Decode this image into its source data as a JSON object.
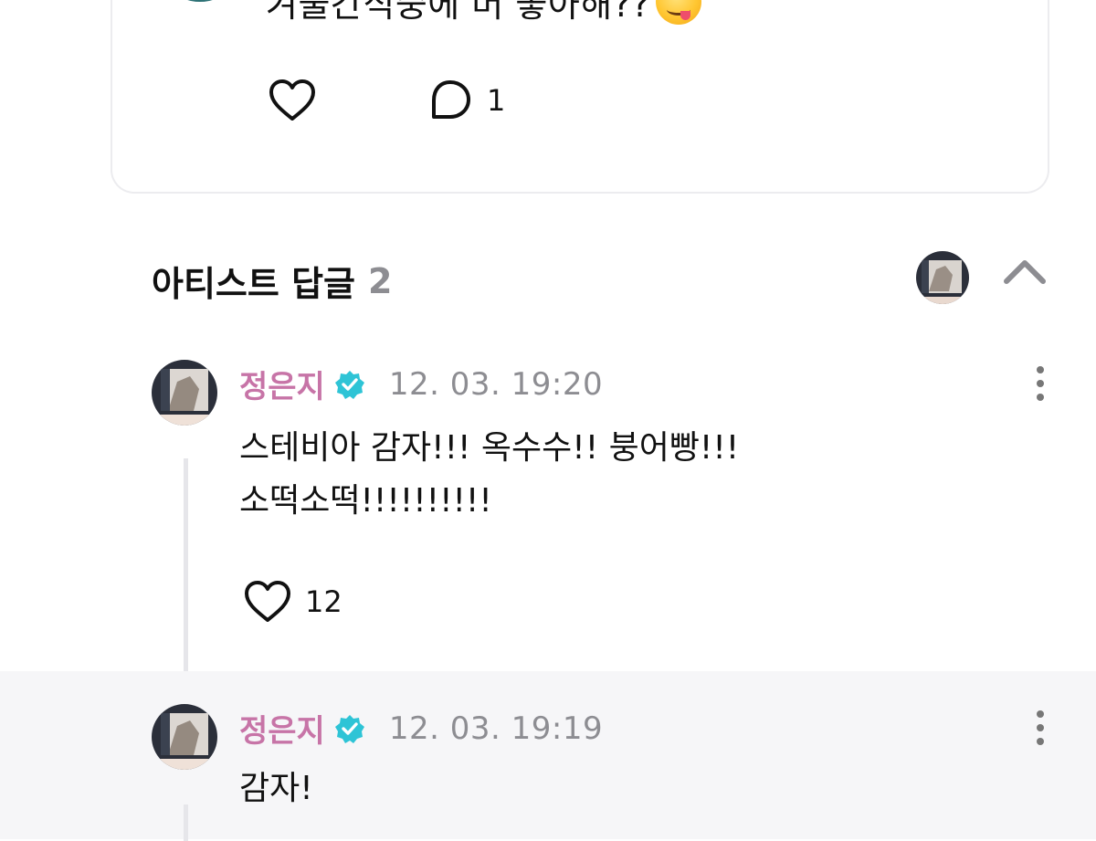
{
  "post": {
    "text": "겨울간식중에 머 좋아해??",
    "emoji": "savoring-food-emoji",
    "comment_count": "1",
    "icons": {
      "like": "heart-icon",
      "comment": "comment-bubble-icon"
    }
  },
  "artist_replies": {
    "title": "아티스트 답글",
    "count": "2",
    "collapse_icon": "chevron-up-icon",
    "items": [
      {
        "author": "정은지",
        "verified": true,
        "timestamp": "12. 03. 19:20",
        "lines": [
          "스테비아 감자!!! 옥수수!! 붕어빵!!!",
          "소떡소떡!!!!!!!!!!"
        ],
        "like_count": "12"
      },
      {
        "author": "정은지",
        "verified": true,
        "timestamp": "12. 03. 19:19",
        "lines": [
          "감자!"
        ]
      }
    ]
  },
  "colors": {
    "author": "#c774a7",
    "verified_badge": "#2ec4d6",
    "muted": "#8d8d92",
    "highlight_row": "#f6f6f8"
  }
}
